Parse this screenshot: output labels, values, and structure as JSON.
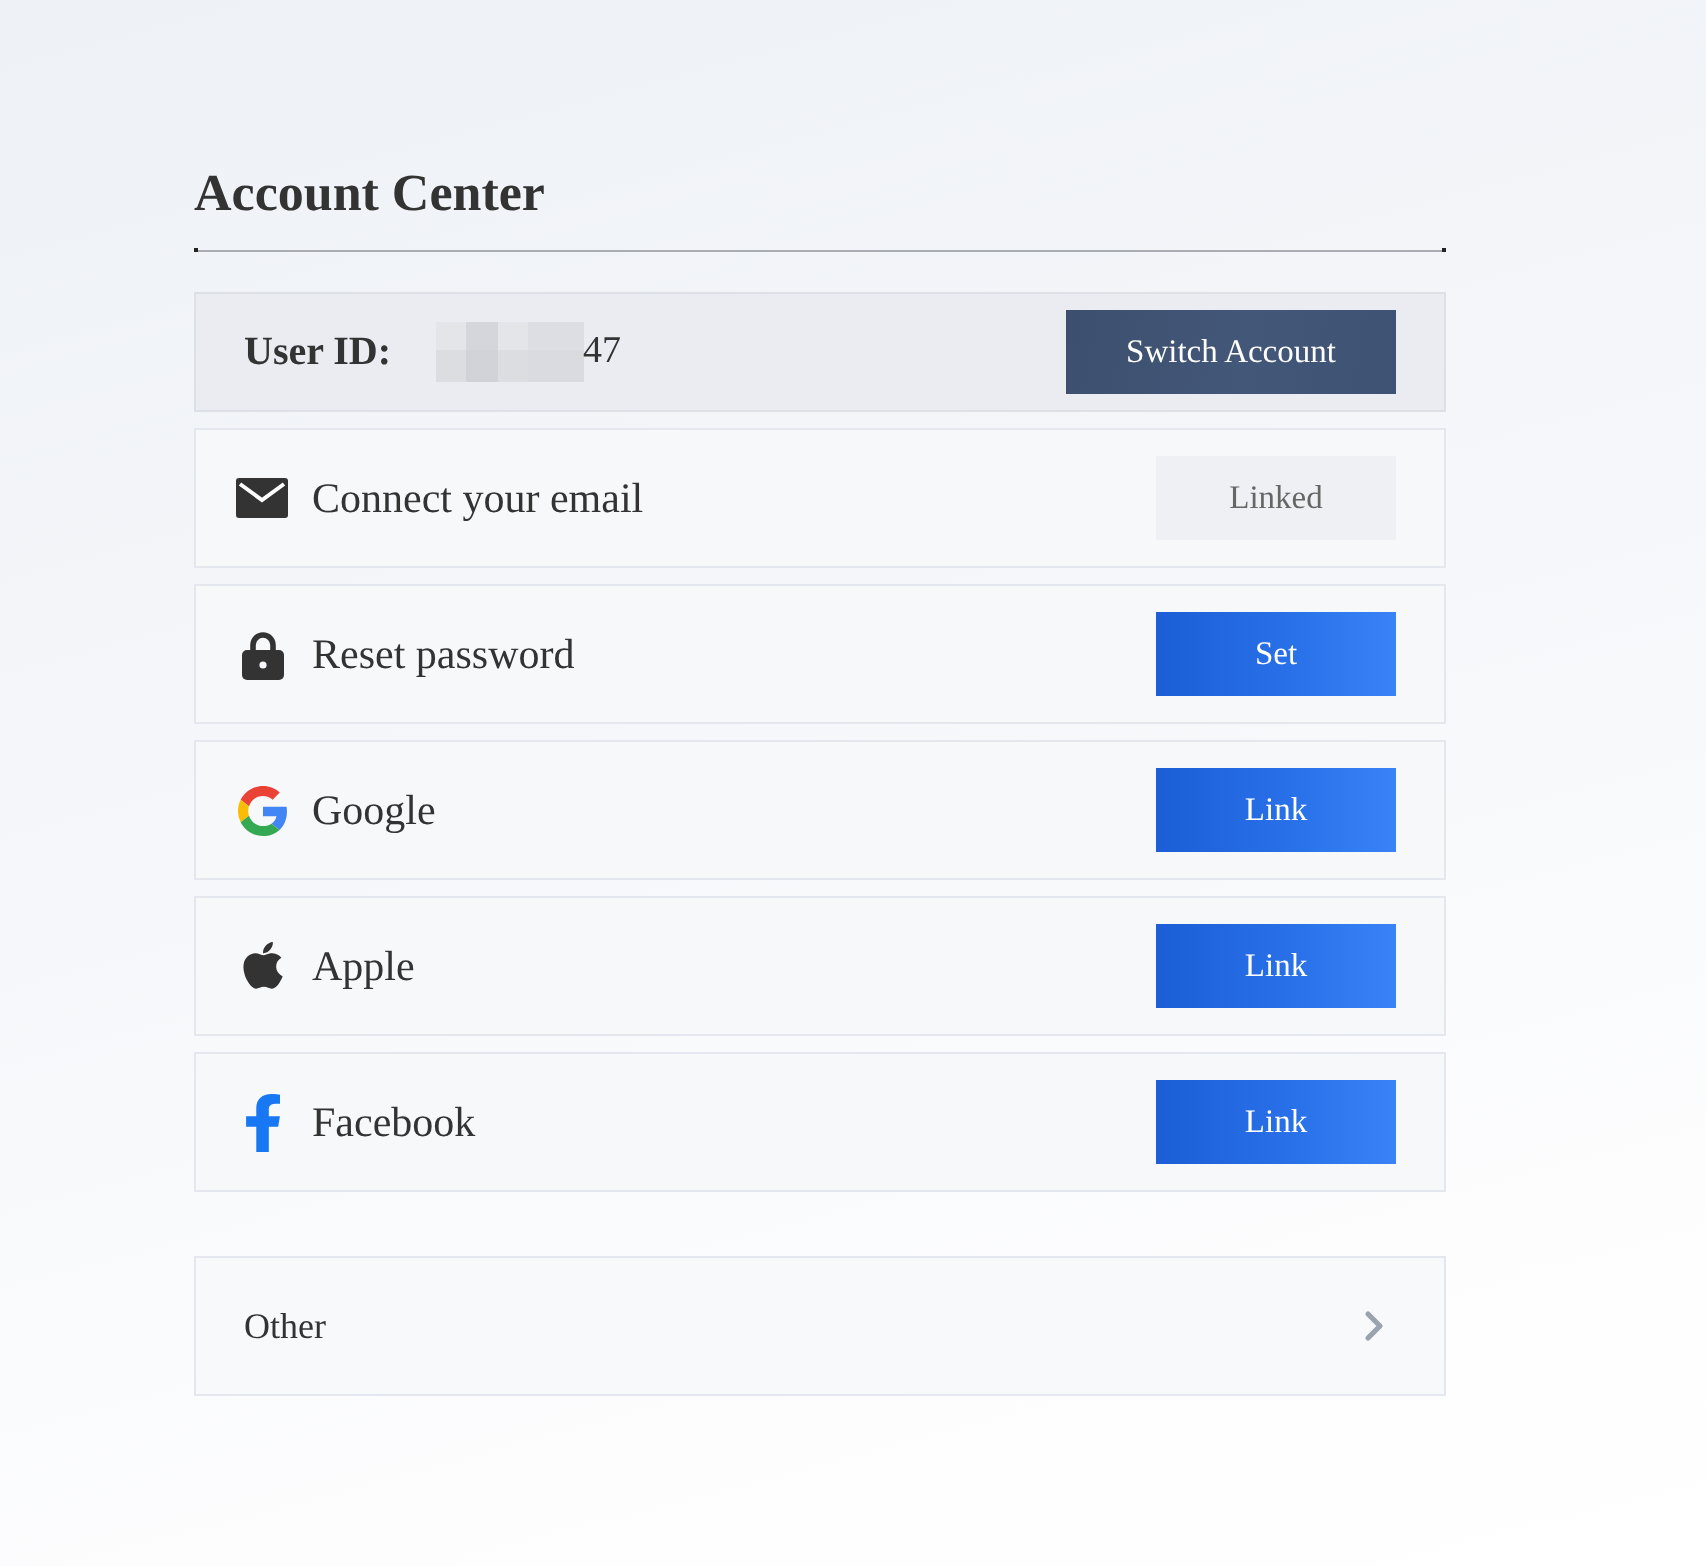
{
  "page": {
    "title": "Account Center"
  },
  "user": {
    "label": "User ID:",
    "id_masked": true,
    "id_visible": "47",
    "switch_button": "Switch Account"
  },
  "bindings": [
    {
      "kind": "email",
      "label": "Connect your email",
      "action": "Linked",
      "linked": true
    },
    {
      "kind": "password",
      "label": "Reset password",
      "action": "Set",
      "linked": false
    },
    {
      "kind": "google",
      "label": "Google",
      "action": "Link",
      "linked": false
    },
    {
      "kind": "apple",
      "label": "Apple",
      "action": "Link",
      "linked": false
    },
    {
      "kind": "facebook",
      "label": "Facebook",
      "action": "Link",
      "linked": false
    }
  ],
  "other": {
    "label": "Other"
  }
}
